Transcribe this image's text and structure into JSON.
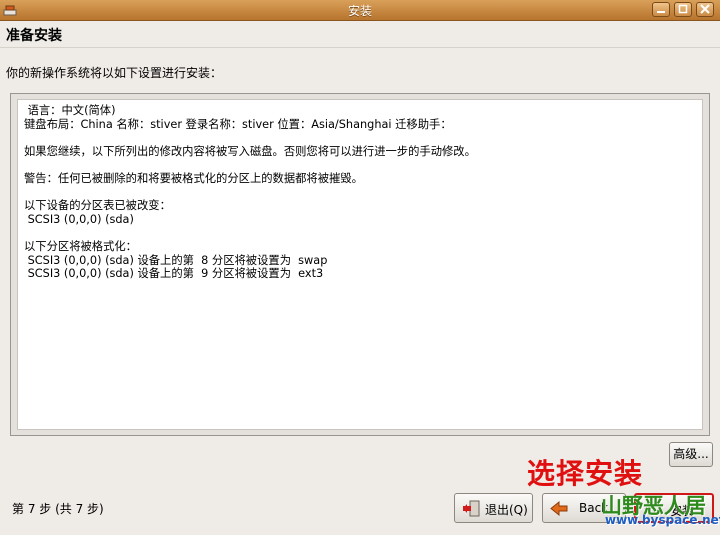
{
  "window": {
    "title": "安装"
  },
  "page": {
    "heading": "准备安装",
    "intro": "你的新操作系统将以如下设置进行安装：",
    "summary_lines": [
      " 语言：中文(简体)",
      "键盘布局：China 名称：stiver 登录名称：stiver 位置：Asia/Shanghai 迁移助手：",
      "",
      "如果您继续，以下所列出的修改内容将被写入磁盘。否则您将可以进行进一步的手动修改。",
      "",
      "警告：任何已被删除的和将要被格式化的分区上的数据都将被摧毁。",
      "",
      "以下设备的分区表已被改变：",
      " SCSI3 (0,0,0) (sda)",
      "",
      "以下分区将被格式化：",
      " SCSI3 (0,0,0) (sda) 设备上的第  8 分区将被设置为  swap",
      " SCSI3 (0,0,0) (sda) 设备上的第  9 分区将被设置为  ext3"
    ]
  },
  "buttons": {
    "advanced": "高级...",
    "quit": "退出(Q)",
    "back": "Back",
    "install": "安装"
  },
  "footer": {
    "step": "第 7 步 (共 7 步)"
  },
  "annotation": {
    "text": "选择安装",
    "color": "#e01010"
  },
  "watermark": {
    "text": "山野恶人居",
    "url": "www.byspace.net"
  }
}
